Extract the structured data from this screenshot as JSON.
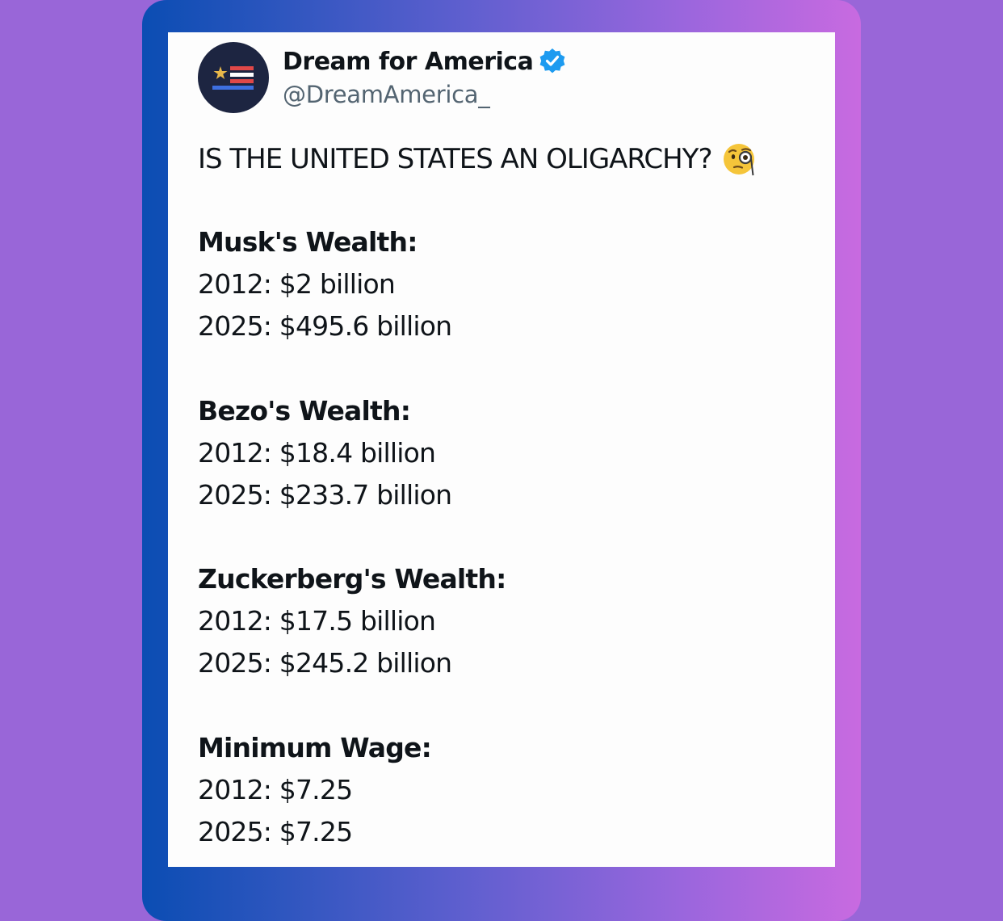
{
  "post": {
    "author": {
      "display_name": "Dream for America",
      "handle": "@DreamAmerica_",
      "verified": true,
      "avatar_icon": "american-flag-logo-icon"
    },
    "headline": "IS THE UNITED STATES AN OLIGARCHY?",
    "headline_emoji": "face-with-monocle-icon",
    "sections": [
      {
        "title": "Musk's Wealth:",
        "lines": [
          "2012: $2 billion",
          "2025: $495.6 billion"
        ]
      },
      {
        "title": "Bezo's Wealth:",
        "lines": [
          "2012: $18.4 billion",
          "2025: $233.7 billion"
        ]
      },
      {
        "title": "Zuckerberg's Wealth:",
        "lines": [
          "2012: $17.5 billion",
          "2025: $245.2 billion"
        ]
      },
      {
        "title": "Minimum Wage:",
        "lines": [
          "2012: $7.25",
          "2025: $7.25"
        ]
      }
    ]
  },
  "colors": {
    "background": "#9966d8",
    "frame_gradient_start": "#0b4db3",
    "frame_gradient_end": "#c86ae0",
    "card": "#fdfdfd",
    "text_primary": "#0f1419",
    "text_secondary": "#536471",
    "verified_blue": "#1d9bf0",
    "avatar_bg": "#1d2541"
  }
}
